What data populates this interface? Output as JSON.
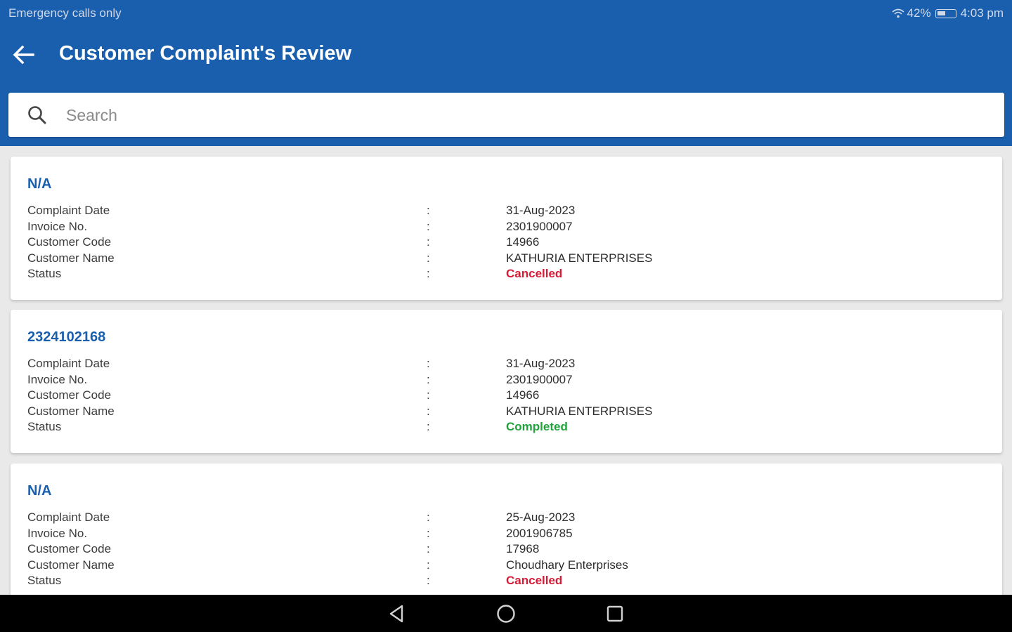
{
  "status_bar": {
    "left_text": "Emergency calls only",
    "battery": "42%",
    "time": "4:03 pm"
  },
  "header": {
    "title": "Customer Complaint's Review",
    "back_icon": "arrow-left-icon"
  },
  "search": {
    "placeholder": "Search",
    "value": "",
    "icon": "search-icon"
  },
  "fields": {
    "complaint_date": "Complaint Date",
    "invoice_no": "Invoice No.",
    "customer_code": "Customer Code",
    "customer_name": "Customer Name",
    "status": "Status",
    "separator": ":"
  },
  "complaints": [
    {
      "title": "N/A",
      "complaint_date": "31-Aug-2023",
      "invoice_no": "2301900007",
      "customer_code": "14966",
      "customer_name": "KATHURIA ENTERPRISES",
      "status": "Cancelled"
    },
    {
      "title": "2324102168",
      "complaint_date": "31-Aug-2023",
      "invoice_no": "2301900007",
      "customer_code": "14966",
      "customer_name": "KATHURIA ENTERPRISES",
      "status": "Completed"
    },
    {
      "title": "N/A",
      "complaint_date": "25-Aug-2023",
      "invoice_no": "2001906785",
      "customer_code": "17968",
      "customer_name": "Choudhary Enterprises",
      "status": "Cancelled"
    }
  ],
  "colors": {
    "primary": "#1a5fad",
    "cancelled": "#d81b36",
    "completed": "#1fa33a"
  },
  "nav_bar": {
    "back": "triangle-back-icon",
    "home": "circle-home-icon",
    "recents": "square-recents-icon"
  }
}
